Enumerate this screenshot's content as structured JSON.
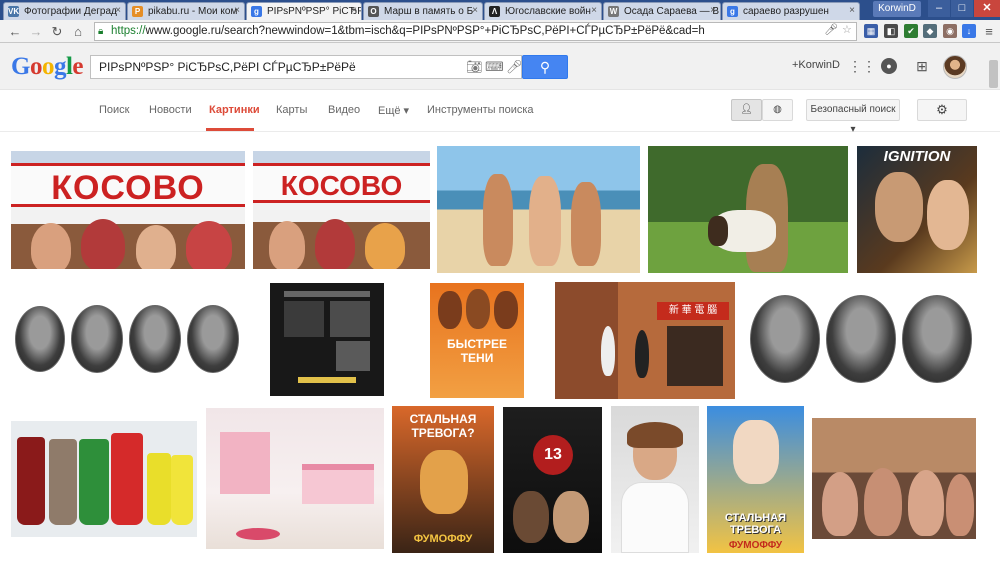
{
  "browser": {
    "tabs": [
      {
        "label": "Фотографии Деград",
        "favicon": "VK",
        "color": "#4a76a8"
      },
      {
        "label": "pikabu.ru - Мои ком",
        "favicon": "P",
        "color": "#e58e26"
      },
      {
        "label": "PIPsPNºPSP° PiCЂPs",
        "favicon": "g",
        "color": "#3a78e7"
      },
      {
        "label": "Марш в память о Б",
        "favicon": "O",
        "color": "#555555"
      },
      {
        "label": "Югославские войн",
        "favicon": "Λ",
        "color": "#222222"
      },
      {
        "label": "Осада Сараева — В",
        "favicon": "W",
        "color": "#777777"
      },
      {
        "label": "сараево разрушен",
        "favicon": "g",
        "color": "#3a78e7"
      }
    ],
    "user_badge": "KorwinD",
    "url_scheme": "https://",
    "url_rest": "www.google.ru/search?newwindow=1&tbm=isch&q=PIPsPNºPSP°+PiCЂPsC,PёPI+CЃPµCЂP±PёPё&cad=h"
  },
  "google": {
    "logo_letters": [
      {
        "ch": "G",
        "color": "#3a78e7"
      },
      {
        "ch": "o",
        "color": "#d53a2f"
      },
      {
        "ch": "o",
        "color": "#f4b400"
      },
      {
        "ch": "g",
        "color": "#3a78e7"
      },
      {
        "ch": "l",
        "color": "#149a47"
      },
      {
        "ch": "e",
        "color": "#d53a2f"
      }
    ],
    "query": "PIPsPNºPSP° PiCЂPsC,PёPI CЃPµCЂP±PёPё",
    "user": "+KorwinD"
  },
  "nav": {
    "search": "Поиск",
    "news": "Новости",
    "images": "Картинки",
    "maps": "Карты",
    "video": "Видео",
    "more": "Ещё ▾",
    "tools": "Инструменты поиска",
    "safe_search": "Безопасный поиск ▾"
  },
  "images": {
    "kosovo1": "КОСОВО",
    "kosovo2": "КОСОВО",
    "ignition": "IGNITION",
    "bystree_title": "БЫСТРЕЕ ТЕНИ",
    "stalnaya1": "СТАЛЬНАЯ ТРЕВОГА?",
    "fumoffu1": "ФУМОФФУ",
    "stalnaya2": "СТАЛЬНАЯ ТРЕВОГА",
    "fumoffu2": "ФУМОФФУ",
    "sign_cn": "新 華 電 腦"
  },
  "icons": {
    "back": "back-arrow-icon",
    "forward": "forward-arrow-icon",
    "reload": "reload-icon",
    "home": "home-icon",
    "star": "star-icon",
    "mic": "microphone-icon",
    "camera": "camera-icon",
    "keyboard": "keyboard-icon",
    "search": "search-magnifier-icon",
    "apps": "apps-grid-icon",
    "notifications": "notifications-icon",
    "share": "share-plus-icon",
    "person": "person-icon",
    "globe": "globe-icon",
    "gear": "gear-icon"
  },
  "colors": {
    "accent": "#dd4b39",
    "search_button": "#4585f2",
    "header_bg": "#f1f1f1"
  }
}
